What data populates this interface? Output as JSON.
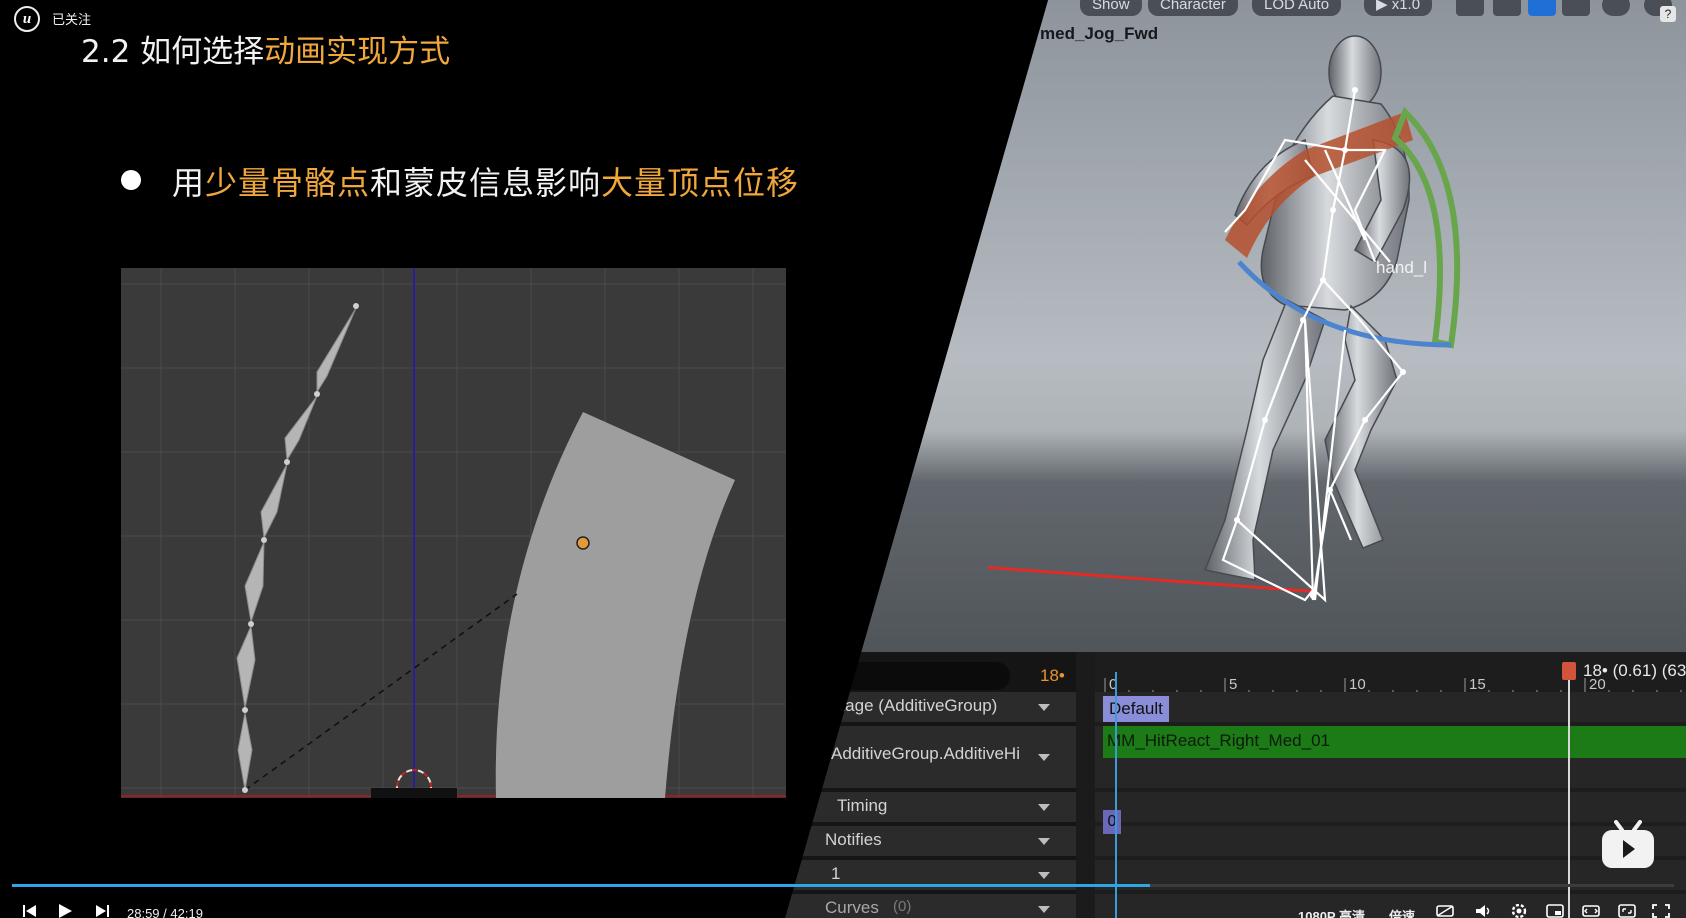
{
  "player": {
    "follow_label": "已关注",
    "logo_text": "u",
    "current_time": "28:59",
    "time_separator": "/",
    "total_time": "42:19",
    "progress": 0.685,
    "quality_label": "1080P 高清",
    "speed_label": "倍速"
  },
  "slide": {
    "title_prefix": "2.2 如何选择",
    "title_highlight": "动画实现方式",
    "bullet_parts": [
      {
        "text": "用",
        "highlight": false
      },
      {
        "text": "少量骨骼点",
        "highlight": true
      },
      {
        "text": "和蒙皮信息影响",
        "highlight": false
      },
      {
        "text": "大量顶点位移",
        "highlight": true
      }
    ],
    "highlight_color": "#f0a73c"
  },
  "viewport": {
    "toolbar": [
      "Show",
      "Character",
      "LOD Auto",
      "x1.0"
    ],
    "help_glyph": "?",
    "asset_name": "med_Jog_Fwd",
    "bone_label": "hand_l"
  },
  "timeline": {
    "frame_indicator": "18•",
    "playhead_label": "18• (0.61) (63",
    "ruler_labels": [
      "0",
      "5",
      "10",
      "15",
      "20"
    ],
    "rows": [
      {
        "label": "ntage (AdditiveGroup)"
      },
      {
        "label": "AdditiveGroup.AdditiveHi"
      },
      {
        "label": "Timing"
      },
      {
        "label": "Notifies"
      },
      {
        "label": "1"
      },
      {
        "label": "Curves",
        "count": "(0)"
      }
    ],
    "slot_tag": "Default",
    "segment_name": "MM_HitReact_Right_Med_01",
    "timing_marker": "0"
  }
}
